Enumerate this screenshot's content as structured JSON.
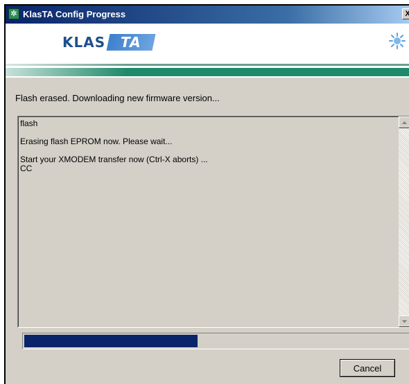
{
  "window": {
    "title": "KlasTA Config Progress",
    "icon": "klasta-app-icon",
    "close_label": "X"
  },
  "banner": {
    "logo_left": "KLAS",
    "logo_right": "TA",
    "icon": "sun-icon"
  },
  "status_text": "Flash erased. Downloading new firmware version...",
  "log": {
    "text": "flash\n\nErasing flash EPROM now. Please wait...\n\nStart your XMODEM transfer now (Ctrl-X aborts) ...\nCC"
  },
  "progress": {
    "percent": 45
  },
  "buttons": {
    "cancel_label": "Cancel"
  },
  "colors": {
    "titlebar": "#0a246a",
    "progress_fill": "#0a246a",
    "stripe": "#1f8a6a",
    "window_bg": "#d4d0c8"
  }
}
